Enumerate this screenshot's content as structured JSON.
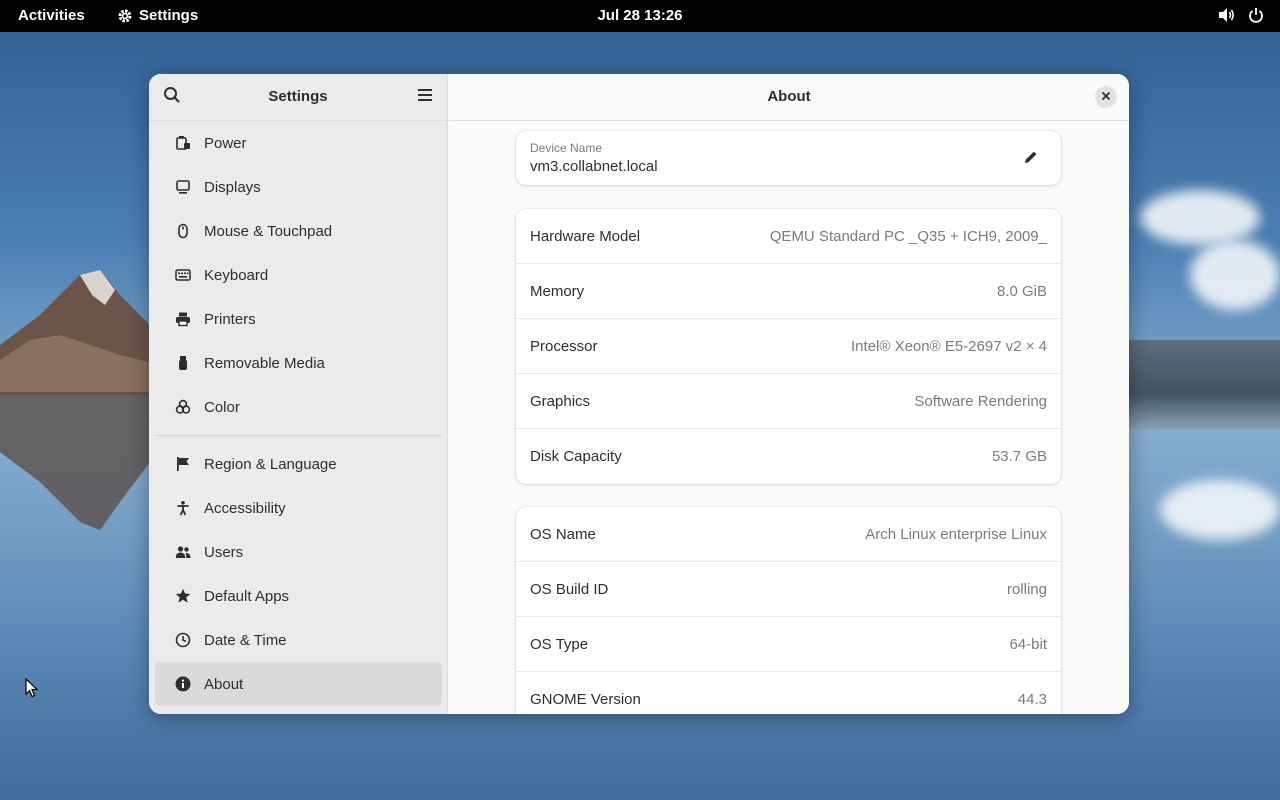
{
  "topbar": {
    "activities": "Activities",
    "app_name": "Settings",
    "clock": "Jul 28  13:26",
    "icons": [
      "volume-icon",
      "power-icon"
    ]
  },
  "sidebar": {
    "title": "Settings",
    "items_group1": [
      {
        "label": "Power",
        "icon": "battery-icon"
      },
      {
        "label": "Displays",
        "icon": "display-icon"
      },
      {
        "label": "Mouse & Touchpad",
        "icon": "mouse-icon"
      },
      {
        "label": "Keyboard",
        "icon": "keyboard-icon"
      },
      {
        "label": "Printers",
        "icon": "printer-icon"
      },
      {
        "label": "Removable Media",
        "icon": "usb-icon"
      },
      {
        "label": "Color",
        "icon": "color-icon"
      }
    ],
    "items_group2": [
      {
        "label": "Region & Language",
        "icon": "flag-icon"
      },
      {
        "label": "Accessibility",
        "icon": "accessibility-icon"
      },
      {
        "label": "Users",
        "icon": "users-icon"
      },
      {
        "label": "Default Apps",
        "icon": "star-icon"
      },
      {
        "label": "Date & Time",
        "icon": "clock-icon"
      },
      {
        "label": "About",
        "icon": "info-icon",
        "selected": true
      }
    ]
  },
  "main": {
    "title": "About",
    "device": {
      "label": "Device Name",
      "value": "vm3.collabnet.local"
    },
    "hardware": [
      {
        "key": "Hardware Model",
        "value": "QEMU Standard PC _Q35 + ICH9, 2009_"
      },
      {
        "key": "Memory",
        "value": "8.0 GiB"
      },
      {
        "key": "Processor",
        "value": "Intel® Xeon® E5-2697 v2 × 4"
      },
      {
        "key": "Graphics",
        "value": "Software Rendering"
      },
      {
        "key": "Disk Capacity",
        "value": "53.7 GB"
      }
    ],
    "os": [
      {
        "key": "OS Name",
        "value": "Arch Linux enterprise Linux"
      },
      {
        "key": "OS Build ID",
        "value": "rolling"
      },
      {
        "key": "OS Type",
        "value": "64-bit"
      },
      {
        "key": "GNOME Version",
        "value": "44.3"
      }
    ]
  },
  "colors": {
    "topbar": "#000000",
    "selected": "#dadada",
    "sidebar": "#ebebeb",
    "window": "#fafafa"
  }
}
